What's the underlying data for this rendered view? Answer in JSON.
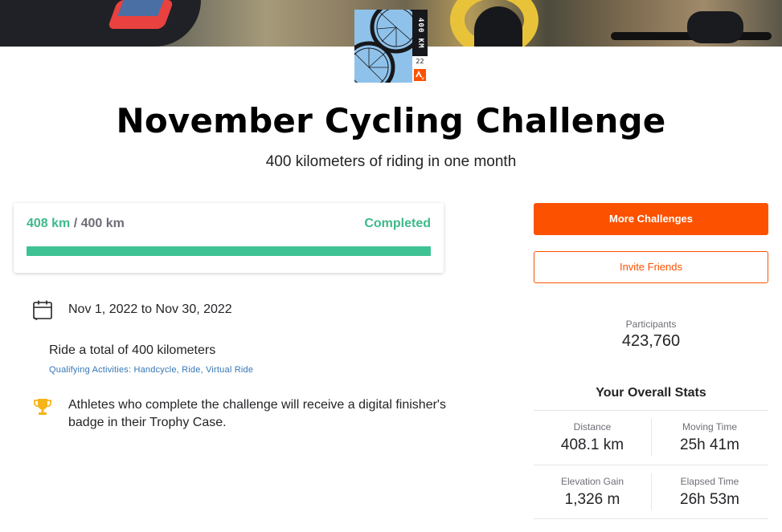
{
  "challenge": {
    "title": "November Cycling Challenge",
    "subtitle": "400 kilometers of riding in one month",
    "badge": {
      "distance_text": "400 KM",
      "year_text": "22"
    }
  },
  "progress": {
    "current": "408 km",
    "separator": " / ",
    "goal": "400 km",
    "status": "Completed",
    "fraction_complete": 1.0,
    "color": "#3fc293"
  },
  "details": {
    "dates": "Nov 1, 2022 to Nov 30, 2022",
    "goal_text": "Ride a total of 400 kilometers",
    "qualifying": "Qualifying Activities: Handcycle, Ride, Virtual Ride",
    "reward": "Athletes who complete the challenge will receive a digital finisher's badge in their Trophy Case.",
    "calendar_icon": "calendar-icon",
    "trophy_icon": "trophy-icon"
  },
  "actions": {
    "more_challenges": "More Challenges",
    "invite_friends": "Invite Friends",
    "accent": "#fc5200"
  },
  "participants": {
    "label": "Participants",
    "value": "423,760"
  },
  "stats": {
    "title": "Your Overall Stats",
    "distance_label": "Distance",
    "distance_value": "408.1 km",
    "moving_time_label": "Moving Time",
    "moving_time_value": "25h 41m",
    "elevation_label": "Elevation Gain",
    "elevation_value": "1,326 m",
    "elapsed_time_label": "Elapsed Time",
    "elapsed_time_value": "26h 53m"
  }
}
